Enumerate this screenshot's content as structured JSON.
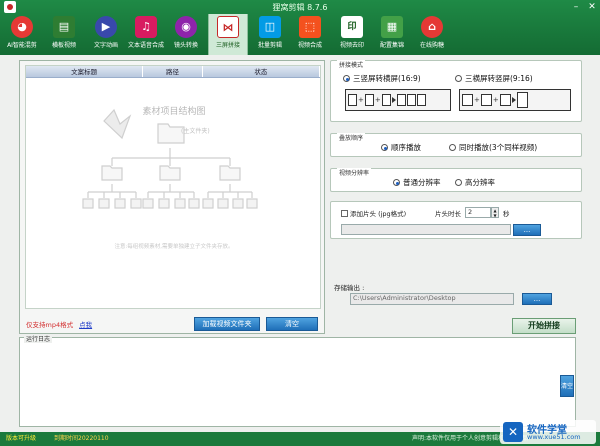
{
  "window": {
    "title": "狸窝剪辑 8.7.6"
  },
  "toolbar": {
    "items": [
      {
        "label": "AI智能混剪",
        "icon": "ai-remix-icon",
        "color": "#e53935",
        "glyph": "◕"
      },
      {
        "label": "横板视频",
        "icon": "landscape-video-icon",
        "color": "#2e7d32",
        "glyph": "▤"
      },
      {
        "label": "文字动画",
        "icon": "text-animation-icon",
        "color": "#3949ab",
        "glyph": "▶"
      },
      {
        "label": "文本语音合成",
        "icon": "text-to-speech-icon",
        "color": "#d81b60",
        "glyph": "♫"
      },
      {
        "label": "镜头转换",
        "icon": "camera-switch-icon",
        "color": "#8e24aa",
        "glyph": "◉"
      },
      {
        "label": "三屏拼接",
        "icon": "three-screen-splice-icon",
        "color": "#ffffff",
        "glyph": "⋈"
      },
      {
        "label": "批量剪辑",
        "icon": "batch-clip-icon",
        "color": "#039be5",
        "glyph": "◫"
      },
      {
        "label": "视频合成",
        "icon": "video-compose-icon",
        "color": "#f4511e",
        "glyph": "⬚"
      },
      {
        "label": "视频去印",
        "icon": "watermark-remove-icon",
        "color": "#ffffff",
        "glyph": "印"
      },
      {
        "label": "配置集锦",
        "icon": "config-collection-icon",
        "color": "#43a047",
        "glyph": "▦"
      },
      {
        "label": "在线购糖",
        "icon": "online-shop-icon",
        "color": "#e53935",
        "glyph": "⌂"
      }
    ]
  },
  "task_table": {
    "columns": [
      "文案标题",
      "路径",
      "状态"
    ],
    "placeholder_title": "素材项目结构图",
    "placeholder_sub": "(主文件夹)",
    "placeholder_hint": "注意:每组视频素材,需要单独建立子文件夹存放。"
  },
  "left_footer": {
    "note": "仅支持mp4格式",
    "link": "点我",
    "load_button": "加载视频文件夹",
    "clear_button": "清空"
  },
  "splice_mode": {
    "label": "拼接模式",
    "option_a": "三竖屏转横屏(16:9)",
    "option_b": "三横屏转竖屏(9:16)",
    "selected": "a"
  },
  "play_order": {
    "label": "叠放顺序",
    "option_a": "顺序播放",
    "option_b": "同时播放(3个同样视频)",
    "selected": "a"
  },
  "resolution": {
    "label": "视频分辨率",
    "option_a": "普通分辨率",
    "option_b": "高分辨率",
    "selected": "a"
  },
  "intro": {
    "checkbox_label": "添加片头 (jpg格式)",
    "duration_label": "片头时长",
    "duration_value": "2",
    "unit": "秒",
    "browse_button": "..."
  },
  "output": {
    "label": "存储输出 :",
    "path": "C:\\Users\\Administrator\\Desktop",
    "browse_button": "...",
    "start_button": "开始拼接"
  },
  "log": {
    "label": "运行日志",
    "clear_button": "清空"
  },
  "status_bar": {
    "version_text": "版本可升级",
    "expire_text": "到期时间20220110",
    "notice": "声明:本软件仅用于个人创意剪辑和原创作品"
  },
  "brand": {
    "glyph": "✕",
    "name": "软件学堂",
    "site": "www.xue51.com"
  }
}
